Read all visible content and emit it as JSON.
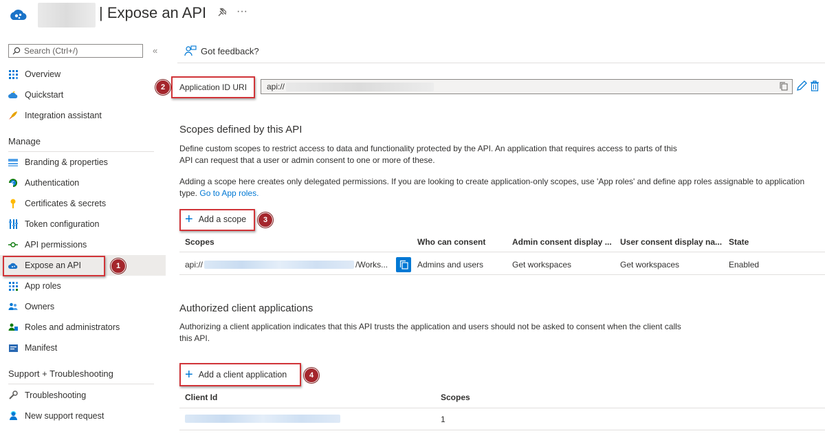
{
  "header": {
    "title": "| Expose an API",
    "pin_icon": "pin-icon",
    "more_icon": "ellipsis-icon"
  },
  "sidebar": {
    "search_placeholder": "Search (Ctrl+/)",
    "collapse_glyph": "«",
    "top_items": [
      {
        "label": "Overview",
        "icon": "overview-icon"
      },
      {
        "label": "Quickstart",
        "icon": "quickstart-icon"
      },
      {
        "label": "Integration assistant",
        "icon": "rocket-icon"
      }
    ],
    "manage_heading": "Manage",
    "manage_items": [
      {
        "label": "Branding & properties",
        "icon": "branding-icon"
      },
      {
        "label": "Authentication",
        "icon": "authentication-icon"
      },
      {
        "label": "Certificates & secrets",
        "icon": "key-icon"
      },
      {
        "label": "Token configuration",
        "icon": "token-icon"
      },
      {
        "label": "API permissions",
        "icon": "api-permissions-icon"
      },
      {
        "label": "Expose an API",
        "icon": "cloud-icon",
        "active": true
      },
      {
        "label": "App roles",
        "icon": "app-roles-icon"
      },
      {
        "label": "Owners",
        "icon": "owners-icon"
      },
      {
        "label": "Roles and administrators",
        "icon": "roles-icon"
      },
      {
        "label": "Manifest",
        "icon": "manifest-icon"
      }
    ],
    "support_heading": "Support + Troubleshooting",
    "support_items": [
      {
        "label": "Troubleshooting",
        "icon": "wrench-icon"
      },
      {
        "label": "New support request",
        "icon": "support-icon"
      }
    ]
  },
  "toolbar": {
    "feedback_label": "Got feedback?"
  },
  "app_id_uri": {
    "label": "Application ID URI",
    "value_prefix": "api://"
  },
  "scopes": {
    "heading": "Scopes defined by this API",
    "desc1": "Define custom scopes to restrict access to data and functionality protected by the API. An application that requires access to parts of this",
    "desc2": "API can request that a user or admin consent to one or more of these.",
    "desc3": "Adding a scope here creates only delegated permissions. If you are looking to create application-only scopes, use 'App roles' and define app roles assignable to application",
    "desc4_prefix": "type.",
    "desc4_link": "Go to App roles.",
    "add_label": "Add a scope",
    "columns": [
      "Scopes",
      "Who can consent",
      "Admin consent display ...",
      "User consent display na...",
      "State"
    ],
    "row": {
      "scope_prefix": "api://",
      "scope_suffix": "/Works...",
      "who": "Admins and users",
      "admin_display": "Get workspaces",
      "user_display": "Get workspaces",
      "state": "Enabled"
    }
  },
  "clients": {
    "heading": "Authorized client applications",
    "desc1": "Authorizing a client application indicates that this API trusts the application and users should not be asked to consent when the client calls",
    "desc2": "this API.",
    "add_label": "Add a client application",
    "columns": [
      "Client Id",
      "Scopes"
    ],
    "row": {
      "scopes": "1"
    }
  },
  "callouts": [
    "1",
    "2",
    "3",
    "4"
  ],
  "colors": {
    "accent": "#0078d4",
    "callout_red": "#d13438",
    "badge": "#a4262c"
  }
}
